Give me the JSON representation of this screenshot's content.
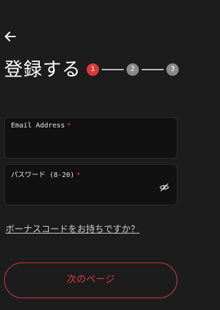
{
  "header": {
    "title": "登録する"
  },
  "stepper": {
    "steps": [
      "1",
      "2",
      "3"
    ],
    "active_color": "#d73b3e",
    "inactive_color": "#8a8a8a"
  },
  "form": {
    "email": {
      "label": "Email Address",
      "required_mark": "*",
      "value": ""
    },
    "password": {
      "label": "パスワード (8-20)",
      "required_mark": "*",
      "value": ""
    }
  },
  "bonus_link": "ボーナスコードをお持ちですか？",
  "next_button": "次のページ",
  "colors": {
    "background": "#1c1c1c",
    "field_background": "#111111",
    "accent": "#d73b3e"
  },
  "icons": {
    "back": "arrow-left-icon",
    "password_toggle": "eye-slash-icon"
  }
}
